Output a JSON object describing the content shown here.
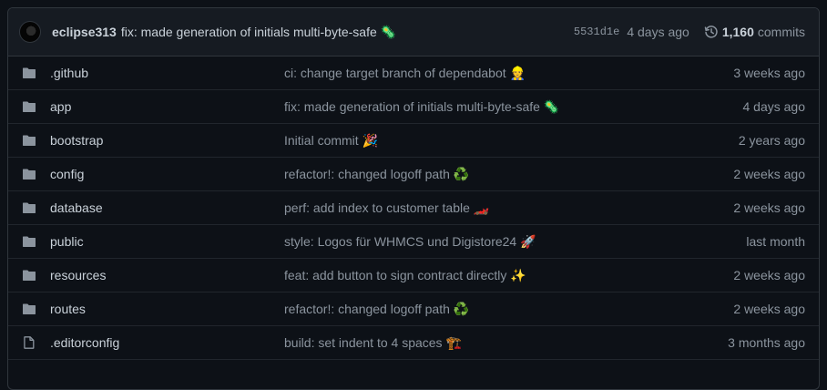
{
  "latest_commit": {
    "author": "eclipse313",
    "message": "fix: made generation of initials multi-byte-safe 🦠",
    "sha": "5531d1e",
    "age": "4 days ago",
    "commit_count": "1,160",
    "commits_label": "commits"
  },
  "files": [
    {
      "type": "folder",
      "name": ".github",
      "message": "ci: change target branch of dependabot 👷",
      "age": "3 weeks ago"
    },
    {
      "type": "folder",
      "name": "app",
      "message": "fix: made generation of initials multi-byte-safe 🦠",
      "age": "4 days ago"
    },
    {
      "type": "folder",
      "name": "bootstrap",
      "message": "Initial commit 🎉",
      "age": "2 years ago"
    },
    {
      "type": "folder",
      "name": "config",
      "message": "refactor!: changed logoff path ♻️",
      "age": "2 weeks ago"
    },
    {
      "type": "folder",
      "name": "database",
      "message": "perf: add index to customer table 🏎️",
      "age": "2 weeks ago"
    },
    {
      "type": "folder",
      "name": "public",
      "message": "style: Logos für WHMCS und Digistore24 🚀",
      "age": "last month"
    },
    {
      "type": "folder",
      "name": "resources",
      "message": "feat: add button to sign contract directly ✨",
      "age": "2 weeks ago"
    },
    {
      "type": "folder",
      "name": "routes",
      "message": "refactor!: changed logoff path ♻️",
      "age": "2 weeks ago"
    },
    {
      "type": "file",
      "name": ".editorconfig",
      "message": "build: set indent to 4 spaces 🏗️",
      "age": "3 months ago"
    }
  ],
  "colors": {
    "background": "#0d1117",
    "header_bg": "#161b22",
    "border": "#30363d",
    "text": "#c9d1d9",
    "muted": "#8b949e"
  }
}
